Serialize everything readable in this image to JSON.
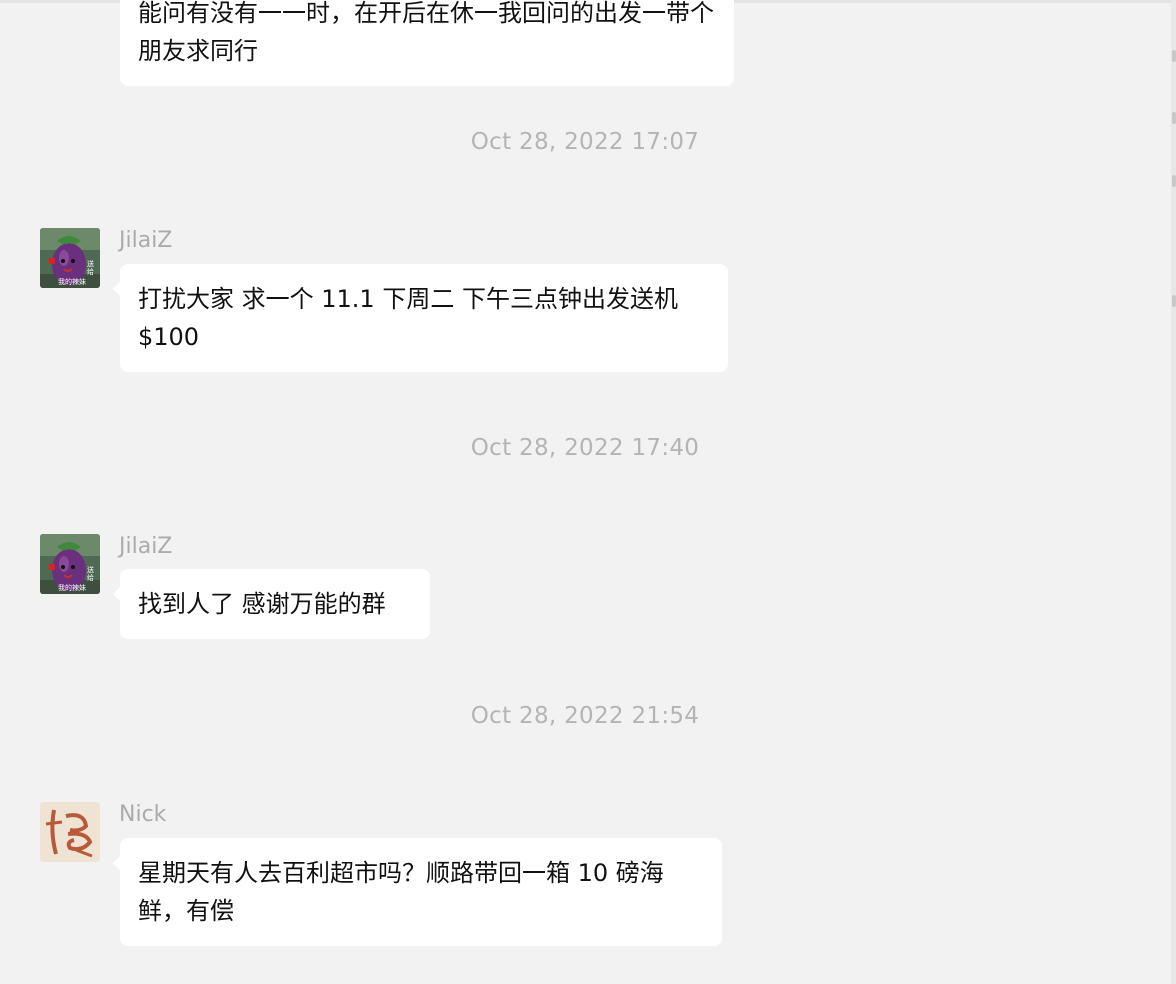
{
  "messages": [
    {
      "text": "能问有没有一一时，在开后在休一我回问的出发一带个朋友求同行"
    },
    {
      "timestamp": "Oct 28, 2022 17:07",
      "sender": "JilaiZ",
      "text": "打扰大家 求一个 11.1 下周二 下午三点钟出发送机 $100"
    },
    {
      "timestamp": "Oct 28, 2022 17:40",
      "sender": "JilaiZ",
      "text": "找到人了 感谢万能的群"
    },
    {
      "timestamp": "Oct 28, 2022 21:54",
      "sender": "Nick",
      "text": "星期天有人去百利超市吗？顺路带回一箱 10 磅海鲜，有偿"
    }
  ],
  "avatars": {
    "jilaiz_overlay_text": "送给我的辣妹",
    "nick_glyph": "㤀"
  },
  "colors": {
    "background": "#f2f2f2",
    "bubble": "#ffffff",
    "timestamp": "#b4b4b4",
    "sender": "#ababab"
  }
}
